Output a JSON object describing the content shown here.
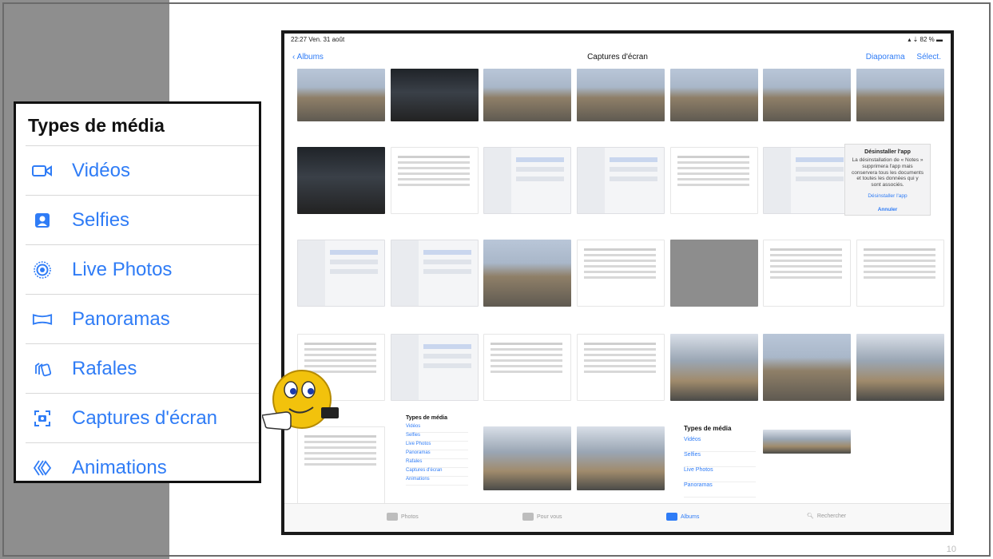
{
  "slide": {
    "page_number": "10"
  },
  "ipad": {
    "status_time": "22:27  Ven. 31 août",
    "status_right": "▴ ⇣ 82 % ▬",
    "nav": {
      "back_label": "Albums",
      "title": "Captures d'écran",
      "diaporama_label": "Diaporama",
      "select_label": "Sélect."
    },
    "alert": {
      "title": "Désinstaller l'app",
      "body": "La désinstallation de « Notes » supprimera l'app mais conservera tous les documents et toutes les données qui y sont associés.",
      "confirm": "Désinstaller l'app",
      "cancel": "Annuler"
    },
    "mini_media_small": {
      "title": "Types de média",
      "items": [
        "Vidéos",
        "Selfies",
        "Live Photos",
        "Panoramas",
        "Rafales",
        "Captures d'écran",
        "Animations"
      ]
    },
    "mini_media_large": {
      "title": "Types de média",
      "items": [
        "Vidéos",
        "Selfies",
        "Live Photos",
        "Panoramas"
      ]
    },
    "tabs": [
      {
        "label": "Photos",
        "icon": "photos-icon",
        "active": false
      },
      {
        "label": "Pour vous",
        "icon": "for-you-icon",
        "active": false
      },
      {
        "label": "Albums",
        "icon": "albums-icon",
        "active": true
      },
      {
        "label": "Rechercher",
        "icon": "search-icon",
        "active": false
      }
    ]
  },
  "media_types": {
    "heading": "Types de média",
    "items": [
      {
        "label": "Vidéos",
        "icon": "video-icon"
      },
      {
        "label": "Selfies",
        "icon": "selfie-icon"
      },
      {
        "label": "Live Photos",
        "icon": "live-photo-icon"
      },
      {
        "label": "Panoramas",
        "icon": "panorama-icon"
      },
      {
        "label": "Rafales",
        "icon": "burst-icon"
      },
      {
        "label": "Captures d'écran",
        "icon": "screenshot-icon"
      },
      {
        "label": "Animations",
        "icon": "animation-icon"
      }
    ]
  },
  "colors": {
    "accent": "#2f7cf6",
    "sidebar": "#8e8e8e"
  }
}
